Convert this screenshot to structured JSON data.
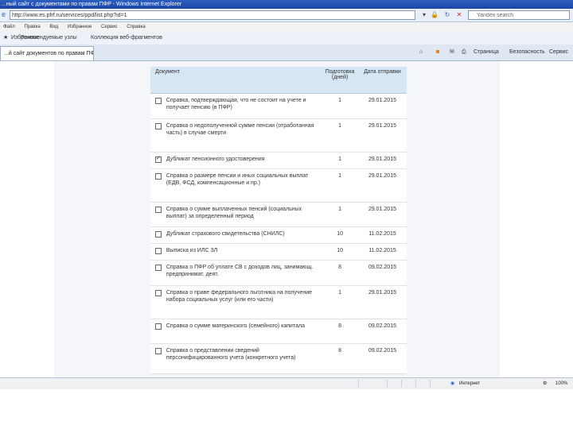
{
  "window": {
    "title": "...ный сайт с документами по правам ПФР - Windows Internet Explorer"
  },
  "address": {
    "url": "http://www.es.pfrf.ru/services/ppd/list.php?id=1",
    "search_placeholder": "Yandex search"
  },
  "menu": {
    "items": [
      "Файл",
      "Правка",
      "Вид",
      "Избранное",
      "Сервис",
      "Справка"
    ]
  },
  "favorites": {
    "items": [
      "Избранное",
      "Рекомендуемые узлы",
      "Коллекция веб-фрагментов"
    ]
  },
  "tab": {
    "label": "...й сайт документов по правам ПФР"
  },
  "command_bar": {
    "page_label": "Страница",
    "safety_label": "Безопасность",
    "tools_label": "Сервис"
  },
  "table": {
    "headers": {
      "document": "Документ",
      "preparation": "Подготовка (дней)",
      "date": "Дата отправки"
    },
    "rows": [
      {
        "name": "Справка, подтверждающая, что не состоит на учете и получает пенсию (в ПФР)",
        "days": "1",
        "date": "29.01.2015",
        "checked": false
      },
      {
        "name": "Справка о недополученной сумме пенсии (отработанная часть) в случае смерти",
        "days": "1",
        "date": "29.01.2015",
        "checked": false
      },
      {
        "name": "Дубликат пенсионного удостоверения",
        "days": "1",
        "date": "29.01.2015",
        "checked": true
      },
      {
        "name": "Справка о размере пенсии и иных социальных выплат (ЕДВ, ФСД, компенсационные и пр.)",
        "days": "1",
        "date": "29.01.2015",
        "checked": false
      },
      {
        "name": "Справка о сумме выплаченных пенсий (социальных выплат) за определенный период",
        "days": "1",
        "date": "29.01.2015",
        "checked": false
      },
      {
        "name": "Дубликат страхового свидетельства (СНИЛС)",
        "days": "10",
        "date": "11.02.2015",
        "checked": false
      },
      {
        "name": "Выписка из ИЛС ЗЛ",
        "days": "10",
        "date": "11.02.2015",
        "checked": false
      },
      {
        "name": "Справка о ПФР об уплате СВ с доходов лиц, занимающ. предпринимат. деят.",
        "days": "8",
        "date": "09.02.2015",
        "checked": false
      },
      {
        "name": "Справка о праве федерального льготника на получение набора социальных услуг (или его части)",
        "days": "1",
        "date": "29.01.2015",
        "checked": false
      },
      {
        "name": "Справка о сумме материнского (семейного) капитала",
        "days": "8",
        "date": "09.02.2015",
        "checked": false
      },
      {
        "name": "Справка о представлении сведений персонифицированного учета (конкретного учета)",
        "days": "8",
        "date": "09.02.2015",
        "checked": false
      }
    ]
  },
  "status": {
    "zone": "Интернет",
    "zoom": "100%"
  }
}
